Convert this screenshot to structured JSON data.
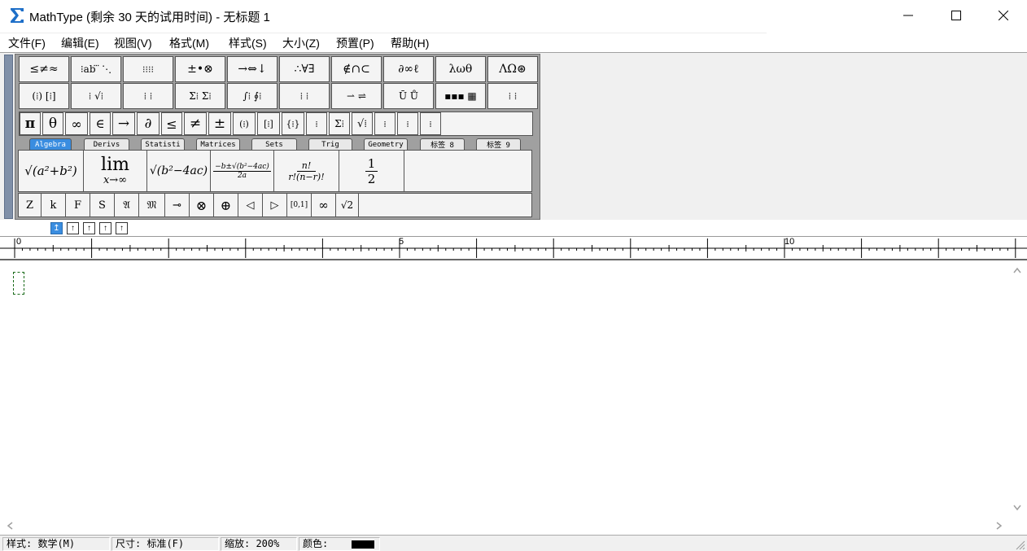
{
  "window": {
    "title": "MathType (剩余 30 天的试用时间) - 无标题 1",
    "minimize_glyph": "—",
    "close_glyph": "✕"
  },
  "menu": [
    "文件(F)",
    "编辑(E)",
    "视图(V)",
    "格式(M)",
    "样式(S)",
    "大小(Z)",
    "预置(P)",
    "帮助(H)"
  ],
  "toolbar_row1": [
    "≤≠≈",
    "⁝ab ⃛ ⋱",
    "⁝⁝⁝⁝",
    "±•⊗",
    "→⇔↓",
    "∴∀∃",
    "∉∩⊂",
    "∂∞ℓ",
    "λωθ",
    "ΛΩ⊛"
  ],
  "toolbar_row2": [
    "(⁞) [⁞]",
    "⁞ √⁞",
    "⁞ ⁞",
    "Σ⁞ Σ⁞",
    "∫⁞ ∮⁞",
    "⁞ ⁞",
    "⇀ ⇌",
    "Ū Ů",
    "▪▪▪ ▦",
    "⁞ ⁞"
  ],
  "symbol_row": [
    "π",
    "θ",
    "∞",
    "∈",
    "→",
    "∂",
    "≤",
    "≠",
    "±",
    "(⁞)",
    "[⁞]",
    "{⁞}",
    "⁞",
    "Σ⁞",
    "√⁞",
    "⁞",
    "⁞",
    "⁞"
  ],
  "tabs": [
    "Algebra",
    "Derivs",
    "Statisti",
    "Matrices",
    "Sets",
    "Trig",
    "Geometry",
    "标签 8",
    "标签 9"
  ],
  "templates": [
    "√(a²+b²)",
    "lim x→∞",
    "√(b²−4ac)",
    "−b±√(b²−4ac) / 2a",
    "n! / r!(n−r)!",
    "1 / 2"
  ],
  "template_labels": {
    "lim_top": "lim",
    "lim_bottom": "x→∞",
    "quad_num": "−b±√(b²−4ac)",
    "quad_den": "2a",
    "comb_num": "n!",
    "comb_den": "r!(n−r)!",
    "half_num": "1",
    "half_den": "2"
  },
  "nudge_row": [
    "Z",
    "k",
    "F",
    "S",
    "𝔄",
    "𝔐",
    "⊸",
    "⊗",
    "⊕",
    "◁",
    "▷",
    "[0,1]",
    "∞",
    "√2"
  ],
  "ruler": {
    "labels": [
      "0",
      "5",
      "10"
    ]
  },
  "status": {
    "style_label": "样式: 数学(M)",
    "size_label": "尺寸: 标准(F)",
    "zoom_label": "缩放: 200%",
    "color_label": "颜色:",
    "color_value": "#000000"
  },
  "icons": {
    "app": "sigma-icon",
    "minimize": "minimize-icon",
    "maximize": "maximize-icon",
    "close": "close-icon"
  }
}
